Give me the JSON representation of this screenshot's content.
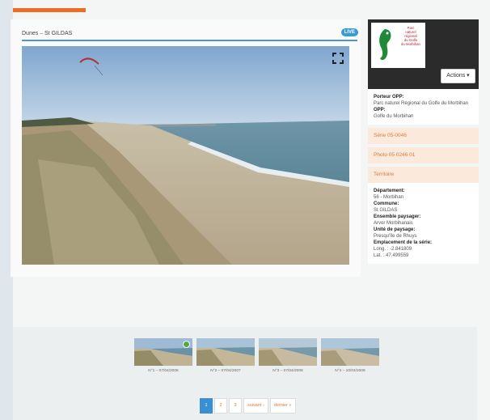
{
  "breadcrumb": {
    "part1": "Dunes",
    "sep": "–",
    "part2": "St GILDAS"
  },
  "photo": {
    "badge": "LIVE"
  },
  "logo": {
    "line1": "Parc",
    "line2": "naturel",
    "line3": "régional",
    "line4": "du Golfe",
    "line5": "du Morbihan"
  },
  "actions": {
    "label": "Actions ▾"
  },
  "porteur": {
    "label1": "Porteur OPP:",
    "value1": "Parc naturel Régional du Golfe du Morbihan",
    "label2": "OPP:",
    "value2": "Golfe du Morbihan"
  },
  "links": {
    "serie": "Série 05-0046",
    "photo": "Photo 05 0246 01",
    "territoire": "Territoire"
  },
  "props": [
    {
      "label": "Département:",
      "value": "56 - Morbihan"
    },
    {
      "label": "Commune:",
      "value": "St GILDAS"
    },
    {
      "label": "Ensemble paysager:",
      "value": "Arvor Morbihanais"
    },
    {
      "label": "Unité de paysage:",
      "value": "Presqu'île de Rhuys"
    },
    {
      "label": "Emplacement de la série:",
      "value": "Long. : -2.841809"
    },
    {
      "label": "",
      "value": "Lat. : 47.499559"
    }
  ],
  "thumbs": [
    {
      "caption": "N°1 – 07/04/2006"
    },
    {
      "caption": "N°2 – 07/04/2007"
    },
    {
      "caption": "N°3 – 07/04/2008"
    },
    {
      "caption": "N°4 – 10/04/2009"
    }
  ],
  "pager": {
    "p1": "1",
    "p2": "2",
    "p3": "3",
    "next": "suivant ›",
    "last": "dernier »"
  }
}
